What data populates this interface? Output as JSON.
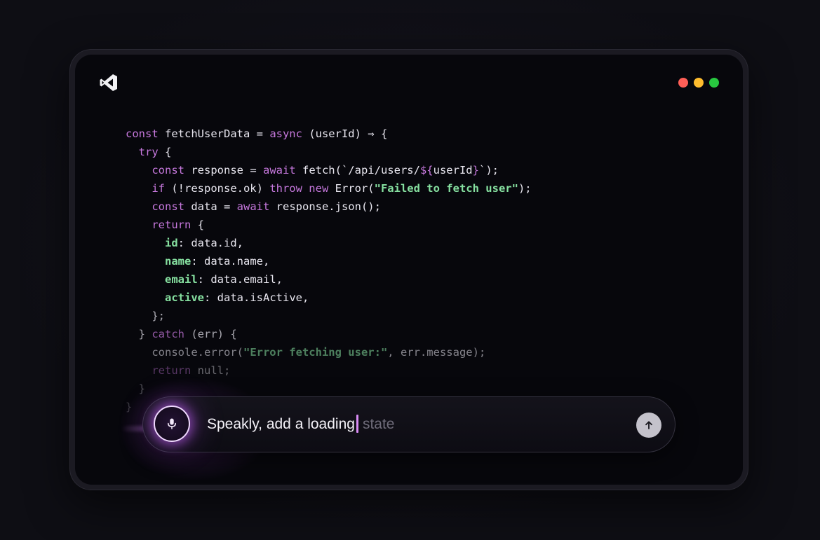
{
  "window": {
    "logo_icon": "vscode-logo-icon",
    "traffic_lights": [
      {
        "name": "close",
        "color": "#ff5f57"
      },
      {
        "name": "minimize",
        "color": "#febc2e"
      },
      {
        "name": "maximize",
        "color": "#28c840"
      }
    ]
  },
  "code": {
    "lines": [
      [
        {
          "t": "const ",
          "c": "kw"
        },
        {
          "t": "fetchUserData = "
        },
        {
          "t": "async ",
          "c": "kw"
        },
        {
          "t": "(userId) ⇒ {"
        }
      ],
      [
        {
          "t": "  "
        },
        {
          "t": "try ",
          "c": "kw"
        },
        {
          "t": "{"
        }
      ],
      [
        {
          "t": "    "
        },
        {
          "t": "const ",
          "c": "kw"
        },
        {
          "t": "response = "
        },
        {
          "t": "await ",
          "c": "kw"
        },
        {
          "t": "fetch(`/api/users/"
        },
        {
          "t": "${",
          "c": "kw"
        },
        {
          "t": "userId"
        },
        {
          "t": "}",
          "c": "kw"
        },
        {
          "t": "`);"
        }
      ],
      [
        {
          "t": "    "
        },
        {
          "t": "if ",
          "c": "kw"
        },
        {
          "t": "(!response.ok) "
        },
        {
          "t": "throw new ",
          "c": "kw"
        },
        {
          "t": "Error("
        },
        {
          "t": "\"Failed to fetch user\"",
          "c": "str"
        },
        {
          "t": ");"
        }
      ],
      [
        {
          "t": "    "
        },
        {
          "t": "const ",
          "c": "kw"
        },
        {
          "t": "data = "
        },
        {
          "t": "await ",
          "c": "kw"
        },
        {
          "t": "response.json();"
        }
      ],
      [
        {
          "t": "    "
        },
        {
          "t": "return ",
          "c": "kw"
        },
        {
          "t": "{"
        }
      ],
      [
        {
          "t": "      "
        },
        {
          "t": "id",
          "c": "prop"
        },
        {
          "t": ": data.id,"
        }
      ],
      [
        {
          "t": "      "
        },
        {
          "t": "name",
          "c": "prop"
        },
        {
          "t": ": data.name,"
        }
      ],
      [
        {
          "t": "      "
        },
        {
          "t": "email",
          "c": "prop"
        },
        {
          "t": ": data.email,"
        }
      ],
      [
        {
          "t": "      "
        },
        {
          "t": "active",
          "c": "prop"
        },
        {
          "t": ": data.isActive,"
        }
      ],
      [
        {
          "t": "    };"
        }
      ],
      [
        {
          "t": "  } "
        },
        {
          "t": "catch ",
          "c": "kw"
        },
        {
          "t": "(err) {"
        }
      ],
      [
        {
          "t": "    console.error("
        },
        {
          "t": "\"Error fetching user:\"",
          "c": "str"
        },
        {
          "t": ", err.message);"
        }
      ],
      [
        {
          "t": "    "
        },
        {
          "t": "return ",
          "c": "kw"
        },
        {
          "t": "null;"
        }
      ],
      [
        {
          "t": "  }"
        }
      ],
      [
        {
          "t": "}"
        }
      ]
    ],
    "fade": [
      0,
      0,
      0,
      0,
      0,
      0,
      0,
      0,
      0,
      0,
      1,
      1,
      2,
      3,
      4,
      5
    ]
  },
  "prompt": {
    "typed_text": "Speakly, add a loading",
    "suggestion_text": "state",
    "mic_icon": "microphone-icon",
    "send_icon": "arrow-up-icon"
  }
}
